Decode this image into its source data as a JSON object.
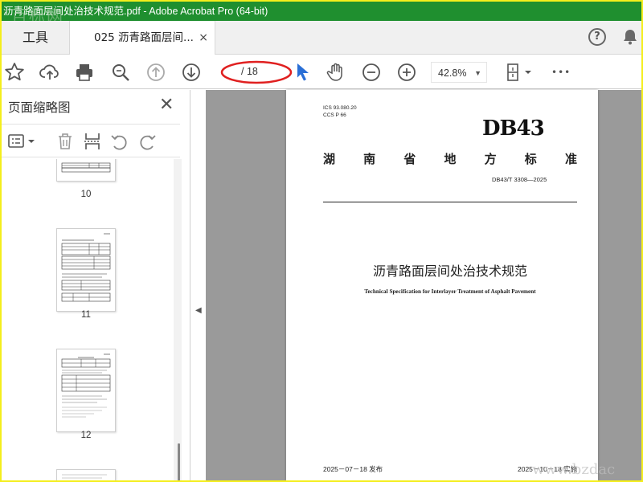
{
  "window": {
    "title": "沥青路面层间处治技术规范.pdf - Adobe Acrobat Pro (64-bit)",
    "watermark_top": "百标网",
    "watermark_bottom": "www.bzdac"
  },
  "tabs": {
    "tools_label": "工具",
    "doc_label": "025 沥青路面层间...",
    "close_glyph": "×"
  },
  "toolbar": {
    "page_current": "",
    "page_total": "/ 18",
    "zoom_value": "42.8%",
    "more_glyph": "•••"
  },
  "sidebar": {
    "title": "页面缩略图",
    "close_glyph": "✕",
    "thumbnails": [
      {
        "label": "10"
      },
      {
        "label": "11"
      },
      {
        "label": "12"
      }
    ]
  },
  "document": {
    "ics": "ICS 93.080.20",
    "ccs": "CCS P 66",
    "logo": "DB43",
    "standard_type_chars": [
      "湖",
      "南",
      "省",
      "地",
      "方",
      "标",
      "准"
    ],
    "standard_no": "DB43/T 3308—2025",
    "title_cn": "沥青路面层间处治技术规范",
    "title_en": "Technical Specification for Interlayer Treatment of Asphalt Pavement",
    "issue_date": "2025－07－18 发布",
    "implement_date": "2025－10－18 实施"
  },
  "colors": {
    "titlebar": "#1f8f2f",
    "highlight_ellipse": "#e02020",
    "cursor": "#2a6fd6",
    "outer_border": "#f4ee1c"
  },
  "icons": [
    "star-icon",
    "upload-icon",
    "print-icon",
    "zoom-search-icon",
    "page-up-icon",
    "page-down-icon",
    "select-cursor-icon",
    "hand-icon",
    "zoom-out-icon",
    "zoom-in-icon",
    "page-layout-icon",
    "more-icon",
    "help-icon",
    "bell-icon",
    "thumbnail-options-icon",
    "delete-icon",
    "insert-page-icon",
    "undo-icon",
    "redo-icon",
    "collapse-arrow-icon"
  ]
}
